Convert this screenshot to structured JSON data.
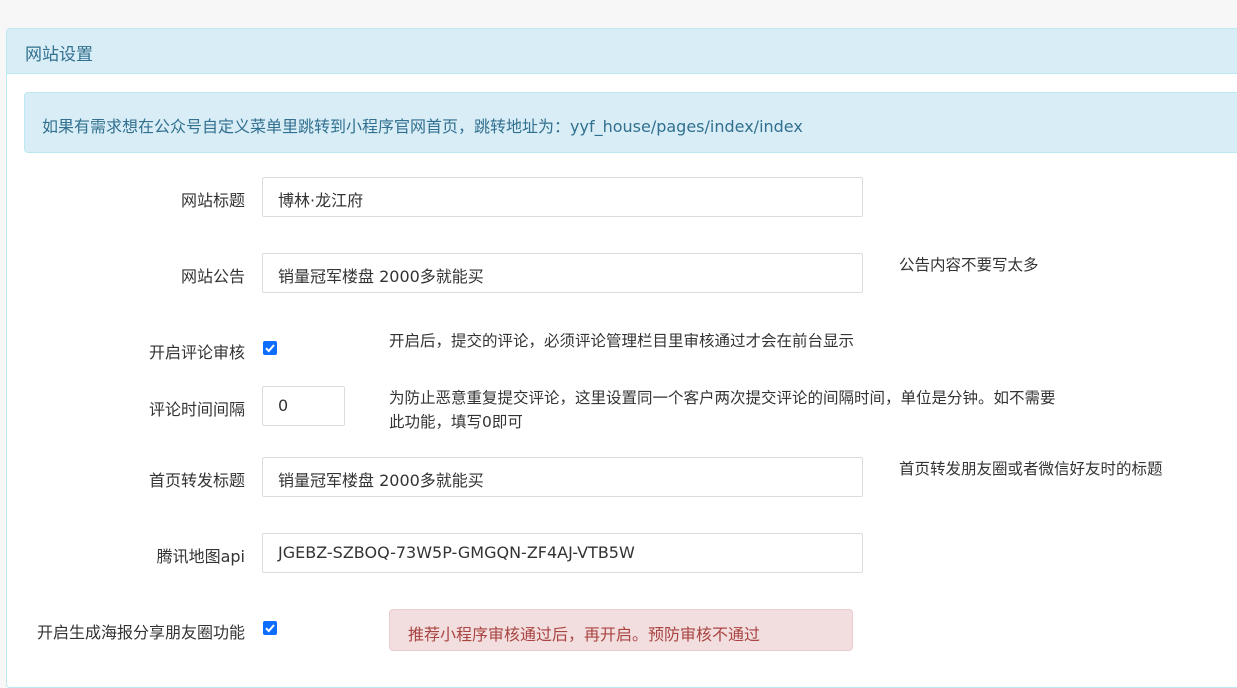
{
  "panel": {
    "title": "网站设置"
  },
  "notice": "如果有需求想在公众号自定义菜单里跳转到小程序官网首页，跳转地址为：yyf_house/pages/index/index",
  "form": {
    "site_title": {
      "label": "网站标题",
      "value": "博林·龙江府"
    },
    "site_announcement": {
      "label": "网站公告",
      "value": "销量冠军楼盘  2000多就能买",
      "help": "公告内容不要写太多"
    },
    "comment_review": {
      "label": "开启评论审核",
      "checked": true,
      "help": "开启后，提交的评论，必须评论管理栏目里审核通过才会在前台显示"
    },
    "comment_interval": {
      "label": "评论时间间隔",
      "value": "0",
      "help_line1": "为防止恶意重复提交评论，这里设置同一个客户两次提交评论的间隔时间，单位是分钟。如不需要",
      "help_line2": "此功能，填写0即可"
    },
    "share_title": {
      "label": "首页转发标题",
      "value": "销量冠军楼盘  2000多就能买",
      "help": "首页转发朋友圈或者微信好友时的标题"
    },
    "map_api": {
      "label": "腾讯地图api",
      "value": "JGEBZ-SZBOQ-73W5P-GMGQN-ZF4AJ-VTB5W"
    },
    "poster_share": {
      "label": "开启生成海报分享朋友圈功能",
      "checked": true,
      "warning": "推荐小程序审核通过后，再开启。预防审核不通过"
    }
  },
  "colors": {
    "accent": "#0d6efd",
    "info_bg": "#d9edf7",
    "info_text": "#31708f",
    "danger_bg": "#f2dede",
    "danger_text": "#a94442"
  },
  "icons": {
    "checkbox": "check-icon"
  }
}
